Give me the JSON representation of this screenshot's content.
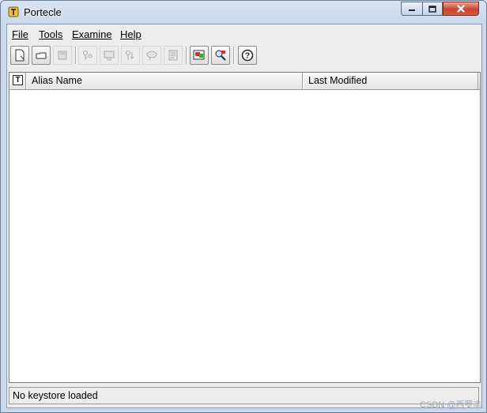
{
  "window": {
    "title": "Portecle"
  },
  "menu": {
    "items": [
      "File",
      "Tools",
      "Examine",
      "Help"
    ]
  },
  "toolbar": {
    "buttons": [
      {
        "icon": "new-keystore-icon",
        "enabled": true
      },
      {
        "icon": "open-keystore-icon",
        "enabled": true
      },
      {
        "icon": "save-keystore-icon",
        "enabled": false
      },
      {
        "icon": "generate-keypair-icon",
        "enabled": false
      },
      {
        "icon": "import-trusted-cert-icon",
        "enabled": false
      },
      {
        "icon": "import-keypair-icon",
        "enabled": false
      },
      {
        "icon": "set-password-icon",
        "enabled": false
      },
      {
        "icon": "keystore-report-icon",
        "enabled": false
      },
      {
        "icon": "examine-certificate-icon",
        "enabled": true
      },
      {
        "icon": "examine-ssl-icon",
        "enabled": true
      },
      {
        "icon": "help-icon",
        "enabled": true
      }
    ]
  },
  "table": {
    "type_header": "T",
    "columns": [
      "Alias Name",
      "Last Modified"
    ]
  },
  "status": {
    "text": "No keystore loaded"
  },
  "watermark": {
    "text": "CSDN @西罗丰"
  },
  "colors": {
    "close_button": "#c7452f",
    "title_bar": "#c9d8ea"
  }
}
